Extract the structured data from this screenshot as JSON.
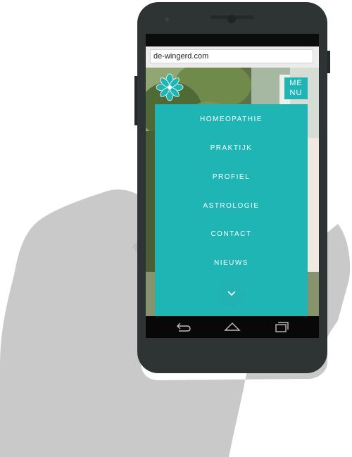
{
  "browser": {
    "url": "de-wingerd.com"
  },
  "site": {
    "menu_button_label_top": "ME",
    "menu_button_label_bottom": "NU",
    "menu_items": [
      {
        "label": "HOMEOPATHIE"
      },
      {
        "label": "PRAKTIJK"
      },
      {
        "label": "PROFIEL"
      },
      {
        "label": "ASTROLOGIE"
      },
      {
        "label": "CONTACT"
      },
      {
        "label": "NIEUWS"
      }
    ],
    "accent_color": "#1fb5b5"
  },
  "icons": {
    "logo": "flower-logo-icon",
    "scroll": "chevron-down-icon",
    "nav_back": "back-icon",
    "nav_home": "home-icon",
    "nav_recents": "recents-icon"
  }
}
